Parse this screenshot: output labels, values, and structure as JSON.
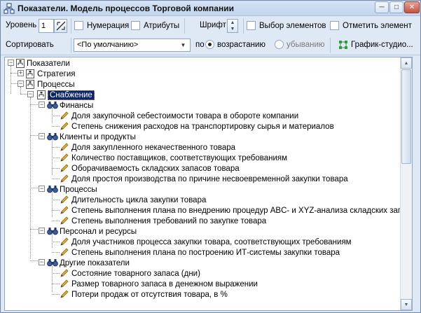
{
  "window": {
    "title": "Показатели. Модель процессов Торговой компании",
    "buttons": {
      "minimize": "─",
      "maximize": "□",
      "close": "✕"
    }
  },
  "toolbar": {
    "level_label": "Уровень",
    "level_value": "1",
    "numbering_label": "Нумерация",
    "attributes_label": "Атрибуты",
    "font_label": "Шрифт",
    "select_elements_label": "Выбор элементов",
    "mark_element_label": "Отметить элемент",
    "sort_label": "Сортировать",
    "sort_value": "<По умолчанию>",
    "order_label": "по",
    "ascending_label": "возрастанию",
    "descending_label": "убыванию",
    "chart_button_label": "График-студио..."
  },
  "tree": {
    "root": "Показатели",
    "strategy": "Стратегия",
    "processes": "Процессы",
    "supply": "Снабжение",
    "groups": [
      {
        "label": "Финансы",
        "items": [
          "Доля закупочной себестоимости товара в обороте компании",
          "Степень снижения расходов на транспортировку сырья и материалов"
        ]
      },
      {
        "label": "Клиенты и продукты",
        "items": [
          "Доля закупленного некачественного товара",
          "Количество поставщиков, соответствующих требованиям",
          "Оборачиваемость складских запасов товара",
          "Доля простоя производства по причине несвоевременной закупки товара"
        ]
      },
      {
        "label": "Процессы",
        "items": [
          "Длительность цикла закупки товара",
          "Степень выполнения плана по внедрению процедур ABC- и XYZ-анализа складских запа",
          "Степень выполнения требований по закупке товара"
        ]
      },
      {
        "label": "Персонал и ресурсы",
        "items": [
          "Доля участников процесса закупки товара, соответствующих требованиям",
          "Степень выполнения плана по построению ИТ-системы закупки товара"
        ]
      },
      {
        "label": "Другие показатели",
        "items": [
          "Состояние товарного запаса (дни)",
          "Размер товарного запаса в денежном выражении",
          "Потери продаж от отсутствия товара, в %"
        ]
      }
    ]
  },
  "colors": {
    "window_bg": "#dfe9f5",
    "selection_bg": "#0b246a",
    "indicator_icon": "#d9a520",
    "group_icon": "#3a5da0"
  },
  "icons": {
    "app": "hierarchy-icon",
    "level_tool": "ruler-pencil-icon",
    "chart": "graph-nodes-icon",
    "node": "hierarchy-node-icon",
    "group": "binoculars-icon",
    "indicator": "pencil-icon"
  }
}
